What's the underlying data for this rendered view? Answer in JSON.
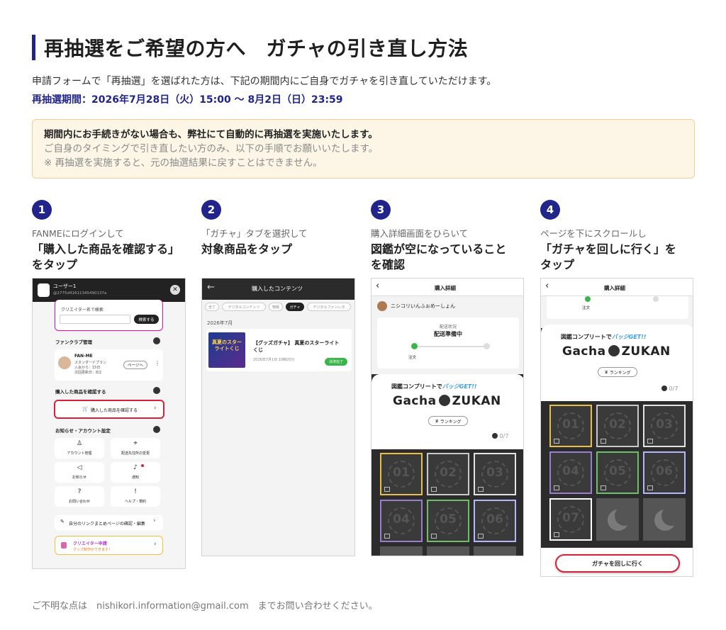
{
  "title": "再抽選をご希望の方へ　ガチャの引き直し方法",
  "intro": "申請フォームで「再抽選」を選ばれた方は、下記の期間内にご自身でガチャを引き直していただけます。",
  "period": "再抽選期間：2026年7月28日（火）15:00 〜 8月2日（日）23:59",
  "notice": {
    "line1": "期間内にお手続きがない場合も、弊社にて自動的に再抽選を実施いたします。",
    "line2": "ご自身のタイミングで引き直したい方のみ、以下の手順でお願いいたします。",
    "line3": "※ 再抽選を実施すると、元の抽選結果に戻すことはできません。"
  },
  "steps": [
    {
      "num": "1",
      "sub": "FANMEにログインして",
      "main1": "「購入した商品を確認する」",
      "main2": "をタップ"
    },
    {
      "num": "2",
      "sub": "「ガチャ」タブを選択して",
      "main1": "対象商品をタップ",
      "main2": ""
    },
    {
      "num": "3",
      "sub": "購入詳細画面をひらいて",
      "main1": "図鑑が空になっていること",
      "main2": "を確認"
    },
    {
      "num": "4",
      "sub": "ページを下にスクロールし",
      "main1": "「ガチャを回しに行く」を",
      "main2": "タップ"
    }
  ],
  "shot1": {
    "user_name": "ユーザー1",
    "user_id": "@2775d41611345490137a",
    "search_placeholder": "クリエイター名で検索",
    "search_button": "検索する",
    "fanclub_header": "ファンクラブ管理",
    "fan_name": "FAN-ME",
    "fan_plan": "スタンダードプラン",
    "fan_join": "入会から：15日",
    "fan_next": "次回更新日：8/2",
    "page_button": "ページへ",
    "purchased_header": "購入した商品を確認する",
    "purchased_button": "購入した商品を確認する",
    "settings_header": "お知らせ・アカウント設定",
    "grid": [
      {
        "label": "アカウント管理",
        "icon": "person-icon"
      },
      {
        "label": "配送先住所の変更",
        "icon": "location-icon"
      },
      {
        "label": "お知らせ",
        "icon": "megaphone-icon"
      },
      {
        "label": "通知",
        "icon": "bell-icon"
      },
      {
        "label": "お問い合わせ",
        "icon": "question-icon"
      },
      {
        "label": "ヘルプ・規約",
        "icon": "info-icon"
      }
    ],
    "link_page": "自分のリンクまとめページの確認・編集",
    "creator_apply": "クリエイター申請",
    "creator_apply_sub": "グッズ制作ができます！"
  },
  "shot2": {
    "header": "購入したコンテンツ",
    "tabs": [
      "全て",
      "デジタルコンテンツ",
      "物販",
      "ガチャ",
      "デジタルファンレタ"
    ],
    "active_tab": 3,
    "month": "2026年7月",
    "item_title1": "【グッズガチャ】 真夏のスターライト",
    "item_title2": "くじ",
    "item_date": "2026年7月1日 10時20分",
    "item_status": "決済完了",
    "thumb_text": "真夏のスターライトくじ"
  },
  "shot3": {
    "header": "購入詳細",
    "seller": "ニシコリいんふぉめーしょん",
    "ship_label": "配送状況",
    "ship_status": "配送準備中",
    "order_label": "注文",
    "complete_pre": "図鑑コンプリートで",
    "complete_badge": "バッジGET!!",
    "logo_left": "Gacha",
    "logo_right": "ZUKAN",
    "ranking": "ランキング",
    "count": "0",
    "count_total": "/7",
    "tiles": [
      "01",
      "02",
      "03",
      "04",
      "05",
      "06"
    ]
  },
  "shot4": {
    "header": "購入詳細",
    "order_label": "注文",
    "complete_pre": "図鑑コンプリートで",
    "complete_badge": "バッジGET!!",
    "logo_left": "Gacha",
    "logo_right": "ZUKAN",
    "ranking": "ランキング",
    "count": "0",
    "count_total": "/7",
    "tiles": [
      "01",
      "02",
      "03",
      "04",
      "05",
      "06",
      "07"
    ],
    "cta": "ガチャを回しに行く"
  },
  "footer": "ご不明な点は　nishikori.information@gmail.com　までお問い合わせください。",
  "colors": {
    "accent": "#20248b",
    "highlight": "#d6213a",
    "green": "#3bb54a"
  }
}
